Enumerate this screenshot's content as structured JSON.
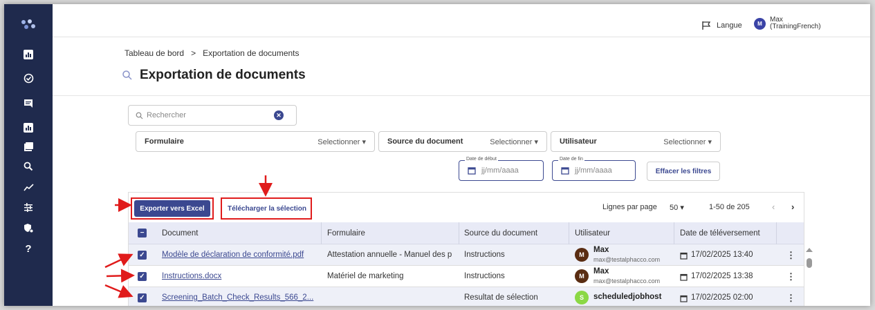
{
  "topbar": {
    "language_label": "Langue",
    "user_initial": "M",
    "user_name_line1": "Max",
    "user_name_line2": "(TrainingFrench)"
  },
  "breadcrumb": {
    "home": "Tableau de bord",
    "separator": ">",
    "current": "Exportation de documents"
  },
  "page": {
    "title": "Exportation de documents"
  },
  "search": {
    "placeholder": "Rechercher"
  },
  "filters": {
    "form": {
      "label": "Formulaire",
      "value": "Selectionner"
    },
    "source": {
      "label": "Source du document",
      "value": "Selectionner"
    },
    "user": {
      "label": "Utilisateur",
      "value": "Selectionner"
    },
    "start_date": {
      "legend": "Date de début",
      "placeholder": "jj/mm/aaaa"
    },
    "end_date": {
      "legend": "Date de fin",
      "placeholder": "jj/mm/aaaa"
    },
    "clear_label": "Effacer les filtres"
  },
  "toolbar": {
    "export_label": "Exporter vers Excel",
    "download_label": "Télécharger la sélection"
  },
  "pagination": {
    "rows_label": "Lignes par page",
    "rows_value": "50",
    "range": "1-50 de 205"
  },
  "table": {
    "headers": [
      "Document",
      "Formulaire",
      "Source du document",
      "Utilisateur",
      "Date de téléversement"
    ],
    "rows": [
      {
        "document": "Modèle de déclaration de conformité.pdf",
        "form": "Attestation annuelle - Manuel des p",
        "source": "Instructions",
        "user_initial": "M",
        "user_name": "Max",
        "user_email": "max@testalphacco.com",
        "date": "17/02/2025 13:40"
      },
      {
        "document": "Instructions.docx",
        "form": "Matériel de marketing",
        "source": "Instructions",
        "user_initial": "M",
        "user_name": "Max",
        "user_email": "max@testalphacco.com",
        "date": "17/02/2025 13:38"
      },
      {
        "document": "Screening_Batch_Check_Results_566_2...",
        "form": "",
        "source": "Resultat de sélection",
        "user_initial": "S",
        "user_name": "scheduledjobhost",
        "user_email": "",
        "date": "17/02/2025 02:00"
      }
    ]
  },
  "colors": {
    "sidebar": "#1f2a4d",
    "primary": "#3b4890",
    "annotation_red": "#e01b1b",
    "avatar_max": "#5a2d12",
    "avatar_scheduled": "#8bd845"
  },
  "icons": [
    "logo-icon",
    "dashboard-icon",
    "check-circle-icon",
    "messages-icon",
    "chart-icon",
    "library-icon",
    "search-icon",
    "trend-icon",
    "filters-icon",
    "security-icon",
    "help-icon",
    "flag-icon",
    "calendar-icon",
    "kebab-icon"
  ]
}
